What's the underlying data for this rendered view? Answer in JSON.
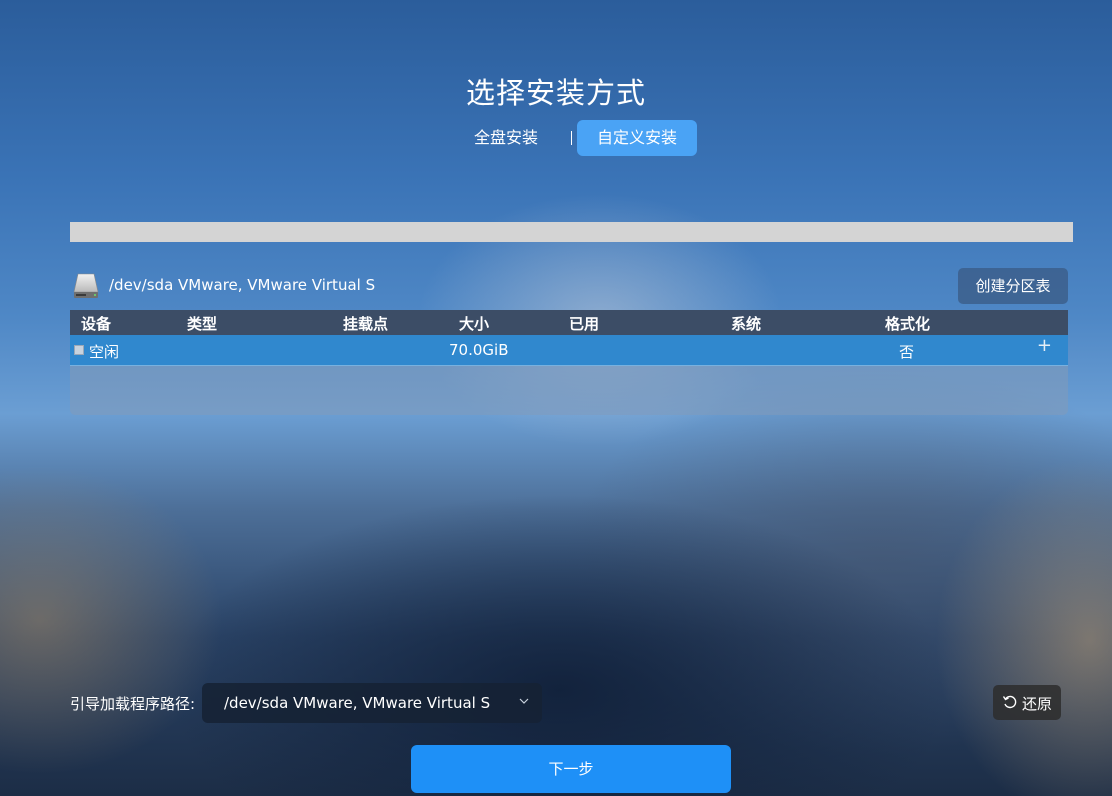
{
  "page": {
    "title": "选择安装方式"
  },
  "mode_tabs": [
    {
      "label": "全盘安装",
      "selected": false
    },
    {
      "label": "自定义安装",
      "selected": true
    }
  ],
  "disk": {
    "label": "/dev/sda VMware, VMware Virtual S",
    "icon": "hard-drive-icon"
  },
  "toolbar": {
    "create_table_label": "创建分区表"
  },
  "partition_table": {
    "columns": [
      "设备",
      "类型",
      "挂载点",
      "大小",
      "已用",
      "系统",
      "格式化"
    ],
    "rows": [
      {
        "device": "空闲",
        "type": "",
        "mount": "",
        "size": "70.0GiB",
        "used": "",
        "system": "",
        "format": "否"
      }
    ],
    "add_icon": "plus-icon"
  },
  "bootloader": {
    "label": "引导加载程序路径:",
    "selected": "/dev/sda VMware, VMware Virtual S",
    "dropdown_icon": "chevron-down-icon"
  },
  "restore": {
    "label": "还原",
    "icon": "undo-icon"
  },
  "next": {
    "label": "下一步"
  },
  "colors": {
    "accent": "#1e90f7",
    "tab_selected": "#4aa3f5",
    "row_selected": "#3088ce",
    "table_header": "#3c4d66"
  }
}
